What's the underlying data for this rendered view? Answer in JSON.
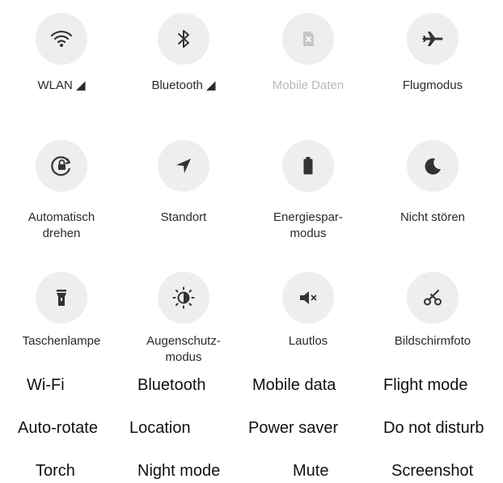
{
  "tiles": [
    {
      "label": "WLAN ◢",
      "icon": "wifi-icon"
    },
    {
      "label": "Bluetooth ◢",
      "icon": "bluetooth-icon"
    },
    {
      "label": "Mobile Daten",
      "icon": "mobile-data-icon",
      "disabled": true
    },
    {
      "label": "Flugmodus",
      "icon": "airplane-icon"
    },
    {
      "label": "Automatisch\ndrehen",
      "icon": "auto-rotate-icon"
    },
    {
      "label": "Standort",
      "icon": "location-icon"
    },
    {
      "label": "Energiespar-\nmodus",
      "icon": "battery-icon"
    },
    {
      "label": "Nicht stören",
      "icon": "moon-icon"
    },
    {
      "label": "Taschenlampe",
      "icon": "flashlight-icon"
    },
    {
      "label": "Augenschutz-\nmodus",
      "icon": "eye-comfort-icon"
    },
    {
      "label": "Lautlos",
      "icon": "mute-icon"
    },
    {
      "label": "Bildschirmfoto",
      "icon": "scissors-icon"
    }
  ],
  "captions": {
    "row1": [
      "Wi-Fi",
      "Bluetooth",
      "Mobile data",
      "Flight mode"
    ],
    "row2": [
      "Auto-rotate",
      "Location",
      "Power saver",
      "Do not disturb"
    ],
    "row3": [
      "Torch",
      "Night mode",
      "Mute",
      "Screenshot"
    ]
  },
  "colors": {
    "icon": "#333333",
    "disabled_icon": "#c0c0c0",
    "circle": "#eeeeee"
  }
}
